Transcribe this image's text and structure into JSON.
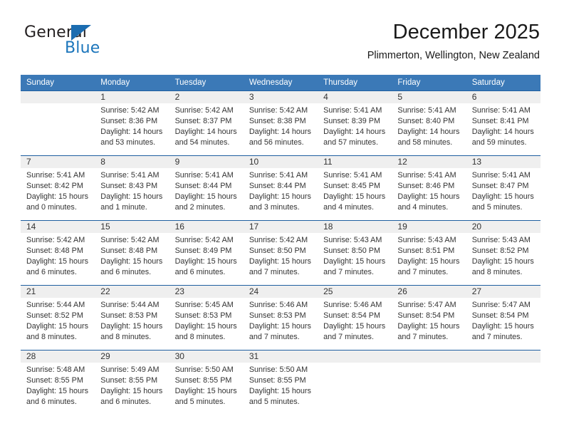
{
  "brand": {
    "name_part1": "General",
    "name_part2": "Blue",
    "triangle_color": "#1b6cb0",
    "blue_color": "#1b75bb"
  },
  "header": {
    "title": "December 2025",
    "subtitle": "Plimmerton, Wellington, New Zealand"
  },
  "theme": {
    "header_blue": "#3b79b7",
    "rule_blue": "#1f5fa0",
    "num_band_gray": "#efefef"
  },
  "weekdays": [
    "Sunday",
    "Monday",
    "Tuesday",
    "Wednesday",
    "Thursday",
    "Friday",
    "Saturday"
  ],
  "weeks": [
    {
      "days": [
        {
          "num": "",
          "sunrise": "",
          "sunset": "",
          "daylight1": "",
          "daylight2": ""
        },
        {
          "num": "1",
          "sunrise": "Sunrise: 5:42 AM",
          "sunset": "Sunset: 8:36 PM",
          "daylight1": "Daylight: 14 hours",
          "daylight2": "and 53 minutes."
        },
        {
          "num": "2",
          "sunrise": "Sunrise: 5:42 AM",
          "sunset": "Sunset: 8:37 PM",
          "daylight1": "Daylight: 14 hours",
          "daylight2": "and 54 minutes."
        },
        {
          "num": "3",
          "sunrise": "Sunrise: 5:42 AM",
          "sunset": "Sunset: 8:38 PM",
          "daylight1": "Daylight: 14 hours",
          "daylight2": "and 56 minutes."
        },
        {
          "num": "4",
          "sunrise": "Sunrise: 5:41 AM",
          "sunset": "Sunset: 8:39 PM",
          "daylight1": "Daylight: 14 hours",
          "daylight2": "and 57 minutes."
        },
        {
          "num": "5",
          "sunrise": "Sunrise: 5:41 AM",
          "sunset": "Sunset: 8:40 PM",
          "daylight1": "Daylight: 14 hours",
          "daylight2": "and 58 minutes."
        },
        {
          "num": "6",
          "sunrise": "Sunrise: 5:41 AM",
          "sunset": "Sunset: 8:41 PM",
          "daylight1": "Daylight: 14 hours",
          "daylight2": "and 59 minutes."
        }
      ]
    },
    {
      "days": [
        {
          "num": "7",
          "sunrise": "Sunrise: 5:41 AM",
          "sunset": "Sunset: 8:42 PM",
          "daylight1": "Daylight: 15 hours",
          "daylight2": "and 0 minutes."
        },
        {
          "num": "8",
          "sunrise": "Sunrise: 5:41 AM",
          "sunset": "Sunset: 8:43 PM",
          "daylight1": "Daylight: 15 hours",
          "daylight2": "and 1 minute."
        },
        {
          "num": "9",
          "sunrise": "Sunrise: 5:41 AM",
          "sunset": "Sunset: 8:44 PM",
          "daylight1": "Daylight: 15 hours",
          "daylight2": "and 2 minutes."
        },
        {
          "num": "10",
          "sunrise": "Sunrise: 5:41 AM",
          "sunset": "Sunset: 8:44 PM",
          "daylight1": "Daylight: 15 hours",
          "daylight2": "and 3 minutes."
        },
        {
          "num": "11",
          "sunrise": "Sunrise: 5:41 AM",
          "sunset": "Sunset: 8:45 PM",
          "daylight1": "Daylight: 15 hours",
          "daylight2": "and 4 minutes."
        },
        {
          "num": "12",
          "sunrise": "Sunrise: 5:41 AM",
          "sunset": "Sunset: 8:46 PM",
          "daylight1": "Daylight: 15 hours",
          "daylight2": "and 4 minutes."
        },
        {
          "num": "13",
          "sunrise": "Sunrise: 5:41 AM",
          "sunset": "Sunset: 8:47 PM",
          "daylight1": "Daylight: 15 hours",
          "daylight2": "and 5 minutes."
        }
      ]
    },
    {
      "days": [
        {
          "num": "14",
          "sunrise": "Sunrise: 5:42 AM",
          "sunset": "Sunset: 8:48 PM",
          "daylight1": "Daylight: 15 hours",
          "daylight2": "and 6 minutes."
        },
        {
          "num": "15",
          "sunrise": "Sunrise: 5:42 AM",
          "sunset": "Sunset: 8:48 PM",
          "daylight1": "Daylight: 15 hours",
          "daylight2": "and 6 minutes."
        },
        {
          "num": "16",
          "sunrise": "Sunrise: 5:42 AM",
          "sunset": "Sunset: 8:49 PM",
          "daylight1": "Daylight: 15 hours",
          "daylight2": "and 6 minutes."
        },
        {
          "num": "17",
          "sunrise": "Sunrise: 5:42 AM",
          "sunset": "Sunset: 8:50 PM",
          "daylight1": "Daylight: 15 hours",
          "daylight2": "and 7 minutes."
        },
        {
          "num": "18",
          "sunrise": "Sunrise: 5:43 AM",
          "sunset": "Sunset: 8:50 PM",
          "daylight1": "Daylight: 15 hours",
          "daylight2": "and 7 minutes."
        },
        {
          "num": "19",
          "sunrise": "Sunrise: 5:43 AM",
          "sunset": "Sunset: 8:51 PM",
          "daylight1": "Daylight: 15 hours",
          "daylight2": "and 7 minutes."
        },
        {
          "num": "20",
          "sunrise": "Sunrise: 5:43 AM",
          "sunset": "Sunset: 8:52 PM",
          "daylight1": "Daylight: 15 hours",
          "daylight2": "and 8 minutes."
        }
      ]
    },
    {
      "days": [
        {
          "num": "21",
          "sunrise": "Sunrise: 5:44 AM",
          "sunset": "Sunset: 8:52 PM",
          "daylight1": "Daylight: 15 hours",
          "daylight2": "and 8 minutes."
        },
        {
          "num": "22",
          "sunrise": "Sunrise: 5:44 AM",
          "sunset": "Sunset: 8:53 PM",
          "daylight1": "Daylight: 15 hours",
          "daylight2": "and 8 minutes."
        },
        {
          "num": "23",
          "sunrise": "Sunrise: 5:45 AM",
          "sunset": "Sunset: 8:53 PM",
          "daylight1": "Daylight: 15 hours",
          "daylight2": "and 8 minutes."
        },
        {
          "num": "24",
          "sunrise": "Sunrise: 5:46 AM",
          "sunset": "Sunset: 8:53 PM",
          "daylight1": "Daylight: 15 hours",
          "daylight2": "and 7 minutes."
        },
        {
          "num": "25",
          "sunrise": "Sunrise: 5:46 AM",
          "sunset": "Sunset: 8:54 PM",
          "daylight1": "Daylight: 15 hours",
          "daylight2": "and 7 minutes."
        },
        {
          "num": "26",
          "sunrise": "Sunrise: 5:47 AM",
          "sunset": "Sunset: 8:54 PM",
          "daylight1": "Daylight: 15 hours",
          "daylight2": "and 7 minutes."
        },
        {
          "num": "27",
          "sunrise": "Sunrise: 5:47 AM",
          "sunset": "Sunset: 8:54 PM",
          "daylight1": "Daylight: 15 hours",
          "daylight2": "and 7 minutes."
        }
      ]
    },
    {
      "days": [
        {
          "num": "28",
          "sunrise": "Sunrise: 5:48 AM",
          "sunset": "Sunset: 8:55 PM",
          "daylight1": "Daylight: 15 hours",
          "daylight2": "and 6 minutes."
        },
        {
          "num": "29",
          "sunrise": "Sunrise: 5:49 AM",
          "sunset": "Sunset: 8:55 PM",
          "daylight1": "Daylight: 15 hours",
          "daylight2": "and 6 minutes."
        },
        {
          "num": "30",
          "sunrise": "Sunrise: 5:50 AM",
          "sunset": "Sunset: 8:55 PM",
          "daylight1": "Daylight: 15 hours",
          "daylight2": "and 5 minutes."
        },
        {
          "num": "31",
          "sunrise": "Sunrise: 5:50 AM",
          "sunset": "Sunset: 8:55 PM",
          "daylight1": "Daylight: 15 hours",
          "daylight2": "and 5 minutes."
        },
        {
          "num": "",
          "sunrise": "",
          "sunset": "",
          "daylight1": "",
          "daylight2": ""
        },
        {
          "num": "",
          "sunrise": "",
          "sunset": "",
          "daylight1": "",
          "daylight2": ""
        },
        {
          "num": "",
          "sunrise": "",
          "sunset": "",
          "daylight1": "",
          "daylight2": ""
        }
      ]
    }
  ]
}
